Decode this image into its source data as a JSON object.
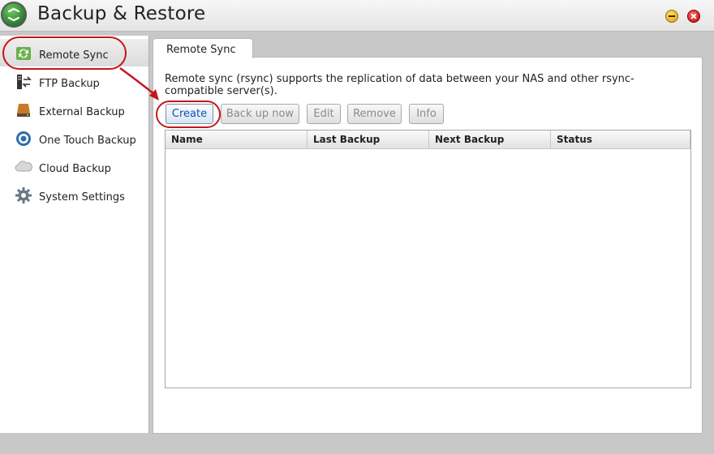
{
  "window": {
    "title": "Backup & Restore",
    "icons": {
      "app": "backup-restore-icon",
      "minimize": "minimize-icon",
      "close": "close-icon"
    }
  },
  "sidebar": {
    "items": [
      {
        "label": "Remote Sync",
        "icon": "remote-sync-icon",
        "active": true
      },
      {
        "label": "FTP Backup",
        "icon": "ftp-backup-icon",
        "active": false
      },
      {
        "label": "External Backup",
        "icon": "external-drive-icon",
        "active": false
      },
      {
        "label": "One Touch Backup",
        "icon": "one-touch-icon",
        "active": false
      },
      {
        "label": "Cloud Backup",
        "icon": "cloud-icon",
        "active": false
      },
      {
        "label": "System Settings",
        "icon": "gear-icon",
        "active": false
      }
    ]
  },
  "main": {
    "tab": "Remote Sync",
    "description": "Remote sync (rsync) supports the replication of data between your NAS and other rsync-compatible server(s).",
    "toolbar": {
      "create": "Create",
      "backup_now": "Back up now",
      "edit": "Edit",
      "remove": "Remove",
      "info": "Info"
    },
    "table": {
      "columns": [
        "Name",
        "Last Backup",
        "Next Backup",
        "Status"
      ],
      "rows": []
    }
  },
  "colors": {
    "annotation": "#c4161c",
    "primary_button_text": "#0a52b8",
    "disabled_button_text": "#8a8a8a"
  }
}
